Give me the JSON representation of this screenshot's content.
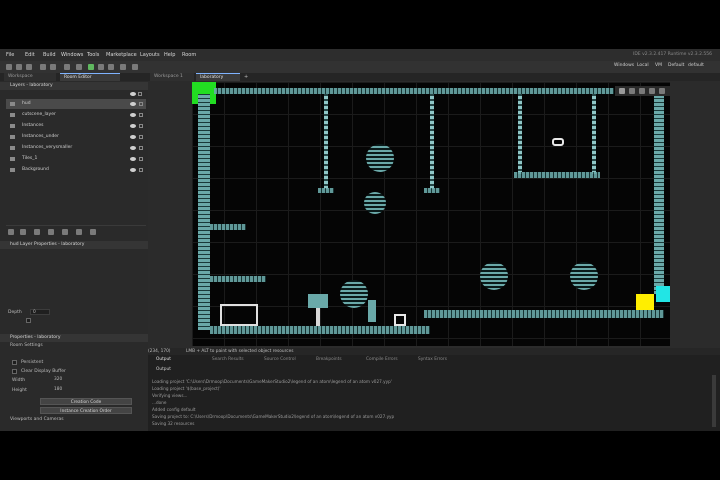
{
  "menu": {
    "file": "File",
    "edit": "Edit",
    "build": "Build",
    "windows": "Windows",
    "tools": "Tools",
    "marketplace": "Marketplace",
    "layouts": "Layouts",
    "help": "Help",
    "room": "Room"
  },
  "title_right": "IDE v2.3.2.417  Runtime v2.3.2.556",
  "toolbar_right": {
    "target": "Windows",
    "local": "Local",
    "vm": "VM",
    "default1": "Default",
    "default2": "default"
  },
  "tabs": {
    "left1": "Workspace",
    "left2": "Room Editor",
    "ws1": "Workspace 1",
    "ws2": "laboratory"
  },
  "layers_header": "Layers - laboratory",
  "layers": [
    {
      "name": "hud",
      "selected": true
    },
    {
      "name": "cutscene_layer",
      "selected": false
    },
    {
      "name": "Instances",
      "selected": false
    },
    {
      "name": "Instances_under",
      "selected": false
    },
    {
      "name": "Instances_verysmaller",
      "selected": false
    },
    {
      "name": "Tiles_1",
      "selected": false
    },
    {
      "name": "Background",
      "selected": false
    }
  ],
  "layer_props_header": "hud Layer Properties - laboratory",
  "depth_label": "Depth",
  "depth_value": "0",
  "props_header": "Properties - laboratory",
  "room_settings": "Room Settings",
  "persistent": "Persistent",
  "clear_display": "Clear Display Buffer",
  "width_label": "Width",
  "width_value": "320",
  "height_label": "Height",
  "height_value": "180",
  "creation_code": "Creation Code",
  "instance_order": "Instance Creation Order",
  "viewports": "Viewports and Cameras",
  "coords": "(234, 170)",
  "status_hint": "LMB + ALT to paint with selected object resources",
  "output_tabs": [
    "Output",
    "Search Results",
    "Source Control",
    "Breakpoints",
    "Compile Errors",
    "Syntax Errors"
  ],
  "output_title": "Output",
  "output_lines": [
    "Loading project 'C:\\Users\\Drmoop\\Documents\\GameMakerStudio2\\legend of an atom\\legend of an atom v027.yyp'",
    "Loading project '$(base_project)'",
    "Verifying views...",
    "...done",
    "Added config default",
    "Saving project to: C:\\Users\\Drmoop\\Documents\\GameMakerStudio2\\legend of an atom\\legend of an atom v027.yyp",
    "Saving 32 resources"
  ],
  "colors": {
    "accent": "#7fb3ff",
    "tile": "#6aa9a9",
    "green_marker": "#22dd22",
    "yellow_block": "#ffee00",
    "cyan_block": "#22e5e5"
  }
}
